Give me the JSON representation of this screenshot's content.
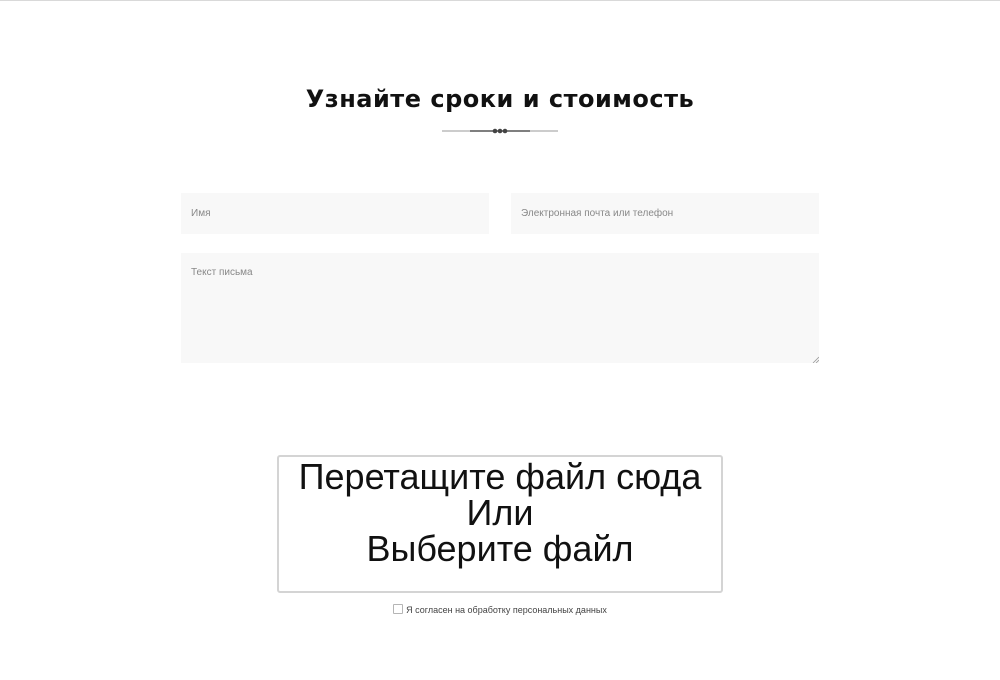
{
  "form": {
    "title": "Узнайте сроки и стоимость",
    "name_placeholder": "Имя",
    "contact_placeholder": "Электронная почта или телефон",
    "message_placeholder": "Текст письма",
    "dropzone": {
      "line1": "Перетащите файл сюда",
      "line2": "Или",
      "line3": "Выберите файл"
    },
    "consent_label": "Я согласен на обработку персональных данных",
    "consent_checked": false
  },
  "colors": {
    "title": "#111111",
    "field_bg": "#f8f8f8",
    "dropzone_border": "#d4d4d4"
  }
}
